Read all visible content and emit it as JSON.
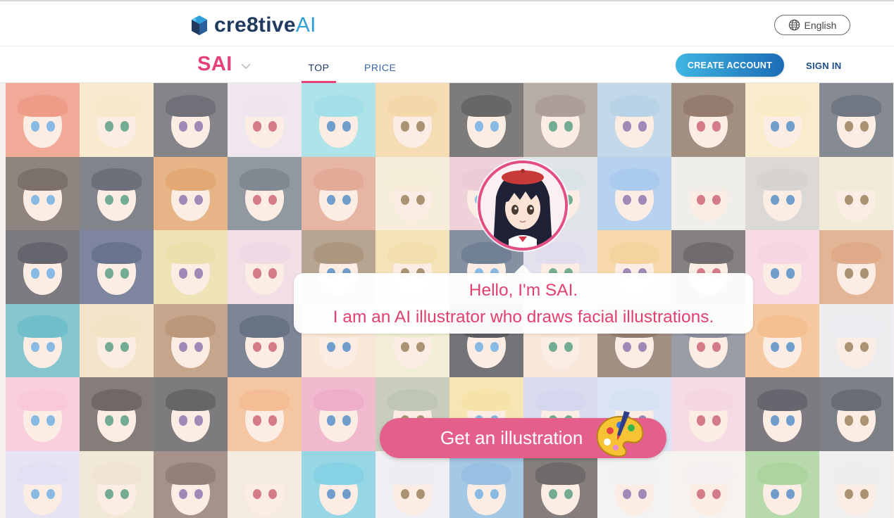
{
  "brand": {
    "name_main": "cre8tive",
    "name_ai": "AI",
    "logo_icon": "cube-logo-icon",
    "colors": {
      "navy": "#203a5f",
      "blue": "#2f9fd8",
      "pink": "#e6407a"
    }
  },
  "header": {
    "language_icon": "globe-icon",
    "language_label": "English"
  },
  "nav": {
    "product": "SAI",
    "product_dropdown_icon": "chevron-down-icon",
    "tabs": [
      {
        "label": "TOP",
        "active": true
      },
      {
        "label": "PRICE",
        "active": false
      }
    ],
    "create_account": "CREATE ACCOUNT",
    "sign_in": "SIGN IN"
  },
  "hero": {
    "background": "grid of AI-generated anime face illustrations",
    "avatar_icon": "sai-avatar-icon",
    "greeting_line1": "Hello, I'm SAI.",
    "greeting_line2": "I am an AI illustrator who draws facial illustrations.",
    "cta_label": "Get an illustration",
    "cta_icon": "paint-palette-icon"
  }
}
